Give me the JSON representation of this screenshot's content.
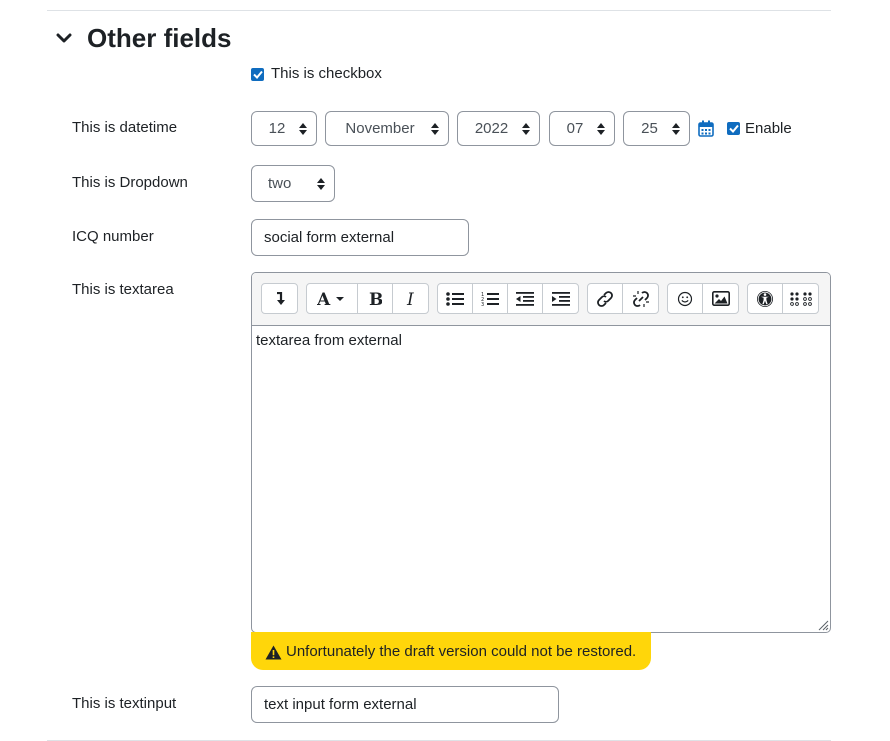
{
  "section": {
    "title": "Other fields",
    "toggle_icon": "chevron-down-icon"
  },
  "checkbox_field": {
    "label": "This is checkbox",
    "checked": true
  },
  "datetime_field": {
    "label": "This is datetime",
    "day": "12",
    "month": "November",
    "year": "2022",
    "hour": "07",
    "minute": "25",
    "calendar_icon": "calendar-icon",
    "enable_label": "Enable",
    "enabled": true
  },
  "dropdown_field": {
    "label": "This is Dropdown",
    "value": "two"
  },
  "icq_field": {
    "label": "ICQ number",
    "value": "social form external"
  },
  "textarea_field": {
    "label": "This is textarea",
    "content": "textarea from external",
    "toolbar": [
      [
        "collapse-icon"
      ],
      [
        "font-style-icon",
        "bold-icon",
        "italic-icon"
      ],
      [
        "unordered-list-icon",
        "ordered-list-icon",
        "outdent-icon",
        "indent-icon"
      ],
      [
        "link-icon",
        "unlink-icon"
      ],
      [
        "emoji-icon",
        "image-icon"
      ],
      [
        "accessibility-checker-icon",
        "screenreader-helper-icon"
      ]
    ]
  },
  "draft_warning": {
    "icon": "warning-icon",
    "text": "Unfortunately the draft version could not be restored."
  },
  "textinput_field": {
    "label": "This is textinput",
    "value": "text input form external"
  },
  "colors": {
    "accent": "#0f6cbf",
    "warning": "#ffd60a",
    "border": "#8f959e"
  }
}
